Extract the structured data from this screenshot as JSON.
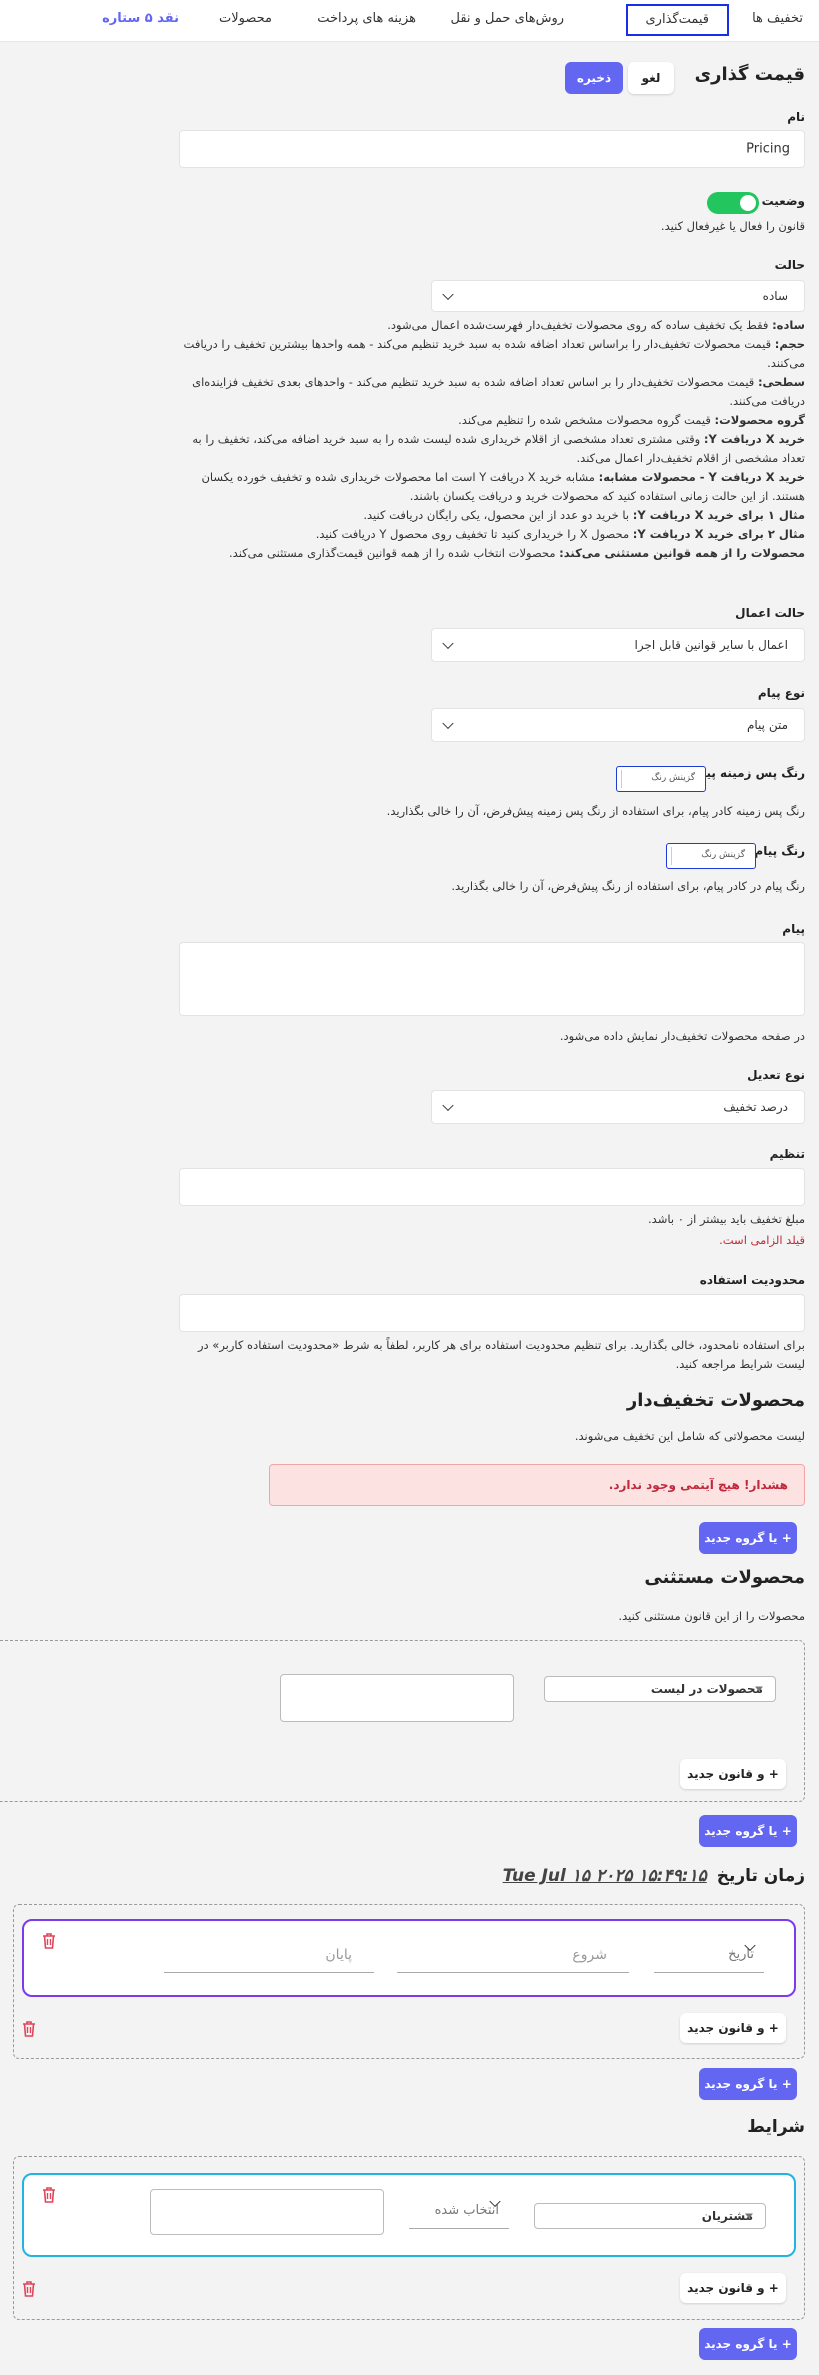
{
  "nav": {
    "tabs": [
      "تخفیف ها",
      "قیمت‌گذاری",
      "روش‌های حمل و نقل",
      "هزینه های پرداخت",
      "محصولات",
      "نقد ۵ ستاره"
    ],
    "active_index": 1
  },
  "header": {
    "title": "قیمت گذاری",
    "cancel": "لغو",
    "save": "ذخیره"
  },
  "name": {
    "label": "نام",
    "value": "Pricing"
  },
  "status": {
    "label": "وضعیت",
    "help": "قانون را فعال یا غیرفعال کنید.",
    "enabled": true
  },
  "mode": {
    "label": "حالت",
    "value": "ساده",
    "descriptions": [
      {
        "title": "ساده:",
        "text": " فقط یک تخفیف ساده که روی محصولات تخفیف‌دار فهرست‌شده اعمال می‌شود."
      },
      {
        "title": "حجم:",
        "text": " قیمت محصولات تخفیف‌دار را براساس تعداد اضافه شده به سبد خرید تنظیم می‌کند - همه واحدها بیشترین تخفیف را دریافت می‌کنند."
      },
      {
        "title": "سطحی:",
        "text": " قیمت محصولات تخفیف‌دار را بر اساس تعداد اضافه شده به سبد خرید تنظیم می‌کند - واحدهای بعدی تخفیف فزاینده‌ای دریافت می‌کنند."
      },
      {
        "title": "گروه محصولات:",
        "text": " قیمت گروه محصولات مشخص شده را تنظیم می‌کند."
      },
      {
        "title": "خرید X دریافت Y:",
        "text": " وقتی مشتری تعداد مشخصی از اقلام خریداری شده لیست شده را به سبد خرید اضافه می‌کند، تخفیف را به تعداد مشخصی از اقلام تخفیف‌دار اعمال می‌کند."
      },
      {
        "title": "خرید X دریافت Y - محصولات مشابه:",
        "text": " مشابه خرید X دریافت Y است اما محصولات خریداری شده و تخفیف خورده یکسان هستند. از این حالت زمانی استفاده کنید که محصولات خرید و دریافت یکسان باشند."
      },
      {
        "title": "مثال ۱ برای خرید X دریافت Y:",
        "text": " با خرید دو عدد از این محصول، یکی رایگان دریافت کنید."
      },
      {
        "title": "مثال ۲ برای خرید X دریافت Y:",
        "text": " محصول X را خریداری کنید تا تخفیف روی محصول Y دریافت کنید."
      },
      {
        "title": "محصولات را از همه قوانین مستثنی می‌کند:",
        "text": " محصولات انتخاب شده را از همه قوانین قیمت‌گذاری مستثنی می‌کند."
      }
    ]
  },
  "apply_mode": {
    "label": "حالت اعمال",
    "value": "اعمال با سایر قوانین قابل اجرا"
  },
  "message_type": {
    "label": "نوع پیام",
    "value": "متن پیام"
  },
  "msg_bg_color": {
    "label": "رنگ پس زمینه پیام",
    "picker": "گزینش رنگ",
    "help": "رنگ پس زمینه کادر پیام، برای استفاده از رنگ پس زمینه پیش‌فرض، آن را خالی بگذارید."
  },
  "msg_color": {
    "label": "رنگ پیام",
    "picker": "گزینش رنگ",
    "help": "رنگ پیام در کادر پیام، برای استفاده از رنگ پیش‌فرض، آن را خالی بگذارید."
  },
  "message": {
    "label": "پیام",
    "help": "در صفحه محصولات تخفیف‌دار نمایش داده می‌شود."
  },
  "adjust_type": {
    "label": "نوع تعدیل",
    "value": "درصد تخفیف"
  },
  "adjust": {
    "label": "تنظیم",
    "help": "مبلغ تخفیف باید بیشتر از ۰ باشد.",
    "error": "قیلد الزامی است."
  },
  "usage_limit": {
    "label": "محدودیت استفاده",
    "help": "برای استفاده نامحدود، خالی بگذارید. برای تنظیم محدودیت استفاده برای هر کاربر، لطفاً به شرط «محدودیت استفاده کاربر» در لیست شرایط مراجعه کنید."
  },
  "discounted_products": {
    "title": "محصولات تخفیف‌دار",
    "help": "لیست محصولاتی که شامل این تخفیف می‌شوند.",
    "warning": "هشدار! هیچ آیتمی وجود ندارد.",
    "add_group": "+ یا گروه جدید"
  },
  "excluded_products": {
    "title": "محصولات مستثنی",
    "help": "محصولات را از این قانون مستثنی کنید.",
    "select": "محصولات در لیست",
    "add_rule": "+ و قانون جدید",
    "add_group": "+ یا گروه جدید"
  },
  "datetime": {
    "title": "زمان تاریخ",
    "current": "Tue Jul ۱۵ ۲۰۲۵ ۱۵:۴۹:۱۵",
    "type": "تاریخ",
    "start": "شروع",
    "end": "پایان",
    "add_rule": "+ و قانون جدید",
    "add_group": "+ یا گروه جدید"
  },
  "conditions": {
    "title": "شرایط",
    "select": "مشتریان",
    "op": "انتخاب شده",
    "add_rule": "+ و قانون جدید",
    "add_group": "+ یا گروه جدید"
  },
  "colors": {
    "accent": "#6366f1",
    "toggle_on": "#22c55e",
    "warning_bg": "#fde2e2",
    "error": "#c0283b",
    "active_tab_border": "#1a2ee8",
    "purple_border": "#7c3aed",
    "cyan_border": "#22b3e0"
  }
}
